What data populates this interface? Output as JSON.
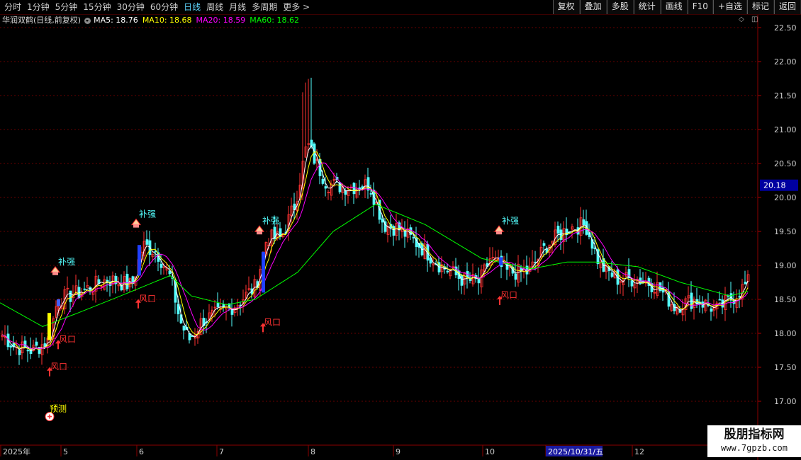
{
  "toolbar": {
    "left_items": [
      {
        "label": "分时",
        "active": false
      },
      {
        "label": "1分钟",
        "active": false
      },
      {
        "label": "5分钟",
        "active": false
      },
      {
        "label": "15分钟",
        "active": false
      },
      {
        "label": "30分钟",
        "active": false
      },
      {
        "label": "60分钟",
        "active": false
      },
      {
        "label": "日线",
        "active": true
      },
      {
        "label": "周线",
        "active": false
      },
      {
        "label": "月线",
        "active": false
      },
      {
        "label": "多周期",
        "active": false
      },
      {
        "label": "更多 >",
        "active": false
      }
    ],
    "right_items": [
      "复权",
      "叠加",
      "多股",
      "统计",
      "画线",
      "F10",
      "+自选",
      "标记",
      "返回"
    ]
  },
  "title": {
    "stock": "华润双鹤(日线,前复权)",
    "ma5": "MA5: 18.76",
    "ma10": "MA10: 18.68",
    "ma20": "MA20: 18.59",
    "ma60": "MA60: 18.62"
  },
  "colors": {
    "up": "#ff3232",
    "down": "#54ffff",
    "ma5": "#ffffff",
    "ma10": "#ffff00",
    "ma20": "#ff00ff",
    "ma60": "#00ff00",
    "grid": "#8b0000",
    "axis_text": "#d0d0d0"
  },
  "y_axis": {
    "ticks": [
      "22.50",
      "22.00",
      "21.50",
      "21.00",
      "20.50",
      "20.00",
      "19.50",
      "19.00",
      "18.50",
      "18.00",
      "17.50",
      "17.00"
    ],
    "current_price": "20.18"
  },
  "x_axis": {
    "labels": [
      "2025年",
      "5",
      "6",
      "7",
      "8",
      "9",
      "10",
      "2025/10/31/五",
      "12"
    ]
  },
  "signals": {
    "buchang_label": "补强",
    "fengkou_label": "风口",
    "yuce_label": "预测"
  },
  "watermark": {
    "title": "股朋指标网",
    "url": "www.7gpzb.com"
  },
  "chart_data": {
    "type": "candlestick",
    "symbol": "华润双鹤",
    "period": "日线",
    "ylim": [
      16.8,
      22.7
    ],
    "y_ticks": [
      17.0,
      17.5,
      18.0,
      18.5,
      19.0,
      19.5,
      20.0,
      20.5,
      21.0,
      21.5,
      22.0,
      22.5
    ],
    "month_labels": [
      "2025年",
      "5",
      "6",
      "7",
      "8",
      "9",
      "10",
      "2025/10/31/五",
      "12"
    ],
    "last_ma": {
      "MA5": 18.76,
      "MA10": 18.68,
      "MA20": 18.59,
      "MA60": 18.62
    },
    "current_price": 20.18,
    "close_trend": [
      [
        0,
        18.0
      ],
      [
        20,
        17.8
      ],
      [
        45,
        17.75
      ],
      [
        68,
        17.9
      ],
      [
        80,
        18.5
      ],
      [
        110,
        18.6
      ],
      [
        150,
        18.8
      ],
      [
        185,
        18.7
      ],
      [
        200,
        19.3
      ],
      [
        220,
        19.2
      ],
      [
        240,
        18.8
      ],
      [
        252,
        18.2
      ],
      [
        265,
        17.9
      ],
      [
        285,
        18.2
      ],
      [
        310,
        18.3
      ],
      [
        335,
        18.45
      ],
      [
        360,
        18.7
      ],
      [
        375,
        19.4
      ],
      [
        395,
        19.4
      ],
      [
        415,
        19.9
      ],
      [
        432,
        20.8
      ],
      [
        445,
        20.5
      ],
      [
        460,
        20.2
      ],
      [
        490,
        20.15
      ],
      [
        520,
        20.2
      ],
      [
        540,
        19.6
      ],
      [
        560,
        19.55
      ],
      [
        590,
        19.3
      ],
      [
        620,
        19.0
      ],
      [
        650,
        18.8
      ],
      [
        675,
        18.75
      ],
      [
        690,
        19.1
      ],
      [
        715,
        18.9
      ],
      [
        745,
        18.9
      ],
      [
        770,
        19.3
      ],
      [
        800,
        19.55
      ],
      [
        825,
        19.6
      ],
      [
        845,
        19.0
      ],
      [
        870,
        18.8
      ],
      [
        900,
        18.8
      ],
      [
        925,
        18.7
      ],
      [
        950,
        18.4
      ],
      [
        980,
        18.5
      ],
      [
        1010,
        18.35
      ],
      [
        1035,
        18.55
      ],
      [
        1055,
        18.76
      ]
    ],
    "ma60_trend": [
      [
        0,
        18.45
      ],
      [
        60,
        18.1
      ],
      [
        110,
        18.3
      ],
      [
        170,
        18.55
      ],
      [
        240,
        18.85
      ],
      [
        270,
        18.55
      ],
      [
        320,
        18.42
      ],
      [
        360,
        18.5
      ],
      [
        420,
        18.9
      ],
      [
        470,
        19.5
      ],
      [
        530,
        19.9
      ],
      [
        600,
        19.6
      ],
      [
        680,
        19.1
      ],
      [
        750,
        18.95
      ],
      [
        800,
        19.05
      ],
      [
        840,
        19.05
      ],
      [
        900,
        18.98
      ],
      [
        960,
        18.75
      ],
      [
        1030,
        18.55
      ],
      [
        1055,
        18.62
      ]
    ],
    "signals": [
      {
        "label": "补强",
        "x_day": 78,
        "price": 18.95
      },
      {
        "label": "补强",
        "x_day": 192,
        "price": 19.65
      },
      {
        "label": "补强",
        "x_day": 366,
        "price": 19.55
      },
      {
        "label": "补强",
        "x_day": 704,
        "price": 19.55
      },
      {
        "label": "风口",
        "x_day": 70,
        "price": 17.45
      },
      {
        "label": "风口",
        "x_day": 82,
        "price": 17.85
      },
      {
        "label": "风口",
        "x_day": 195,
        "price": 18.45
      },
      {
        "label": "风口",
        "x_day": 371,
        "price": 18.1
      },
      {
        "label": "风口",
        "x_day": 705,
        "price": 18.5
      },
      {
        "label": "预测",
        "x_day": 70,
        "price": 16.9
      }
    ]
  }
}
